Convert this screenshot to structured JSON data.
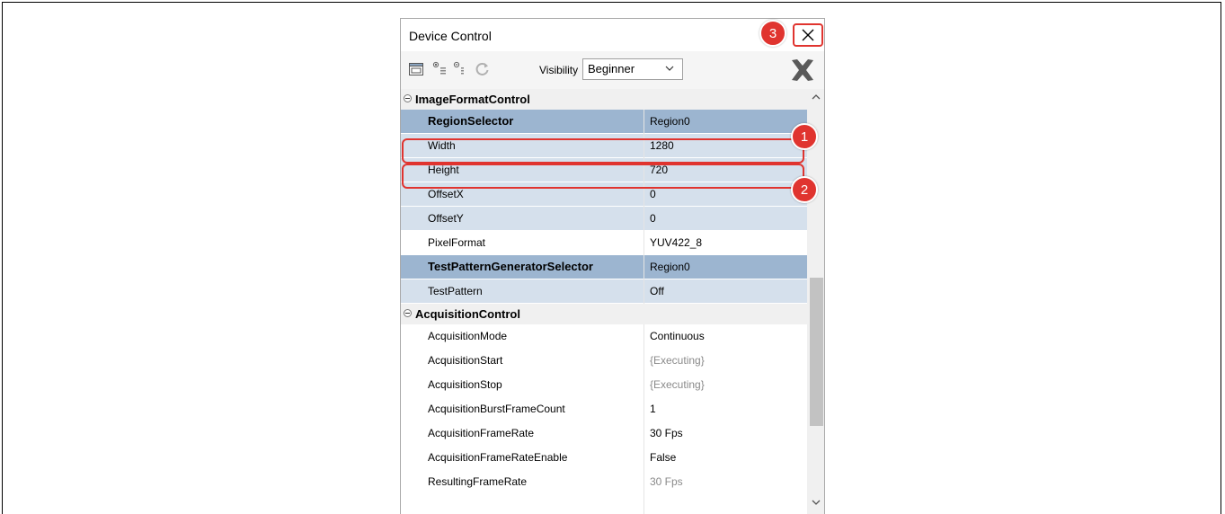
{
  "window": {
    "title": "Device Control"
  },
  "toolbar": {
    "visibility_label": "Visibility",
    "visibility_value": "Beginner",
    "icons": [
      "properties-icon",
      "expand-all-icon",
      "collapse-all-icon",
      "refresh-icon",
      "delete-icon"
    ]
  },
  "categories": [
    {
      "label": "ImageFormatControl",
      "rows": [
        {
          "name": "RegionSelector",
          "value": "Region0",
          "style": "sel"
        },
        {
          "name": "Width",
          "value": "1280",
          "style": "edit"
        },
        {
          "name": "Height",
          "value": "720",
          "style": "edit"
        },
        {
          "name": "OffsetX",
          "value": "0",
          "style": "edit"
        },
        {
          "name": "OffsetY",
          "value": "0",
          "style": "edit"
        },
        {
          "name": "PixelFormat",
          "value": "YUV422_8",
          "style": "white"
        },
        {
          "name": "TestPatternGeneratorSelector",
          "value": "Region0",
          "style": "sel"
        },
        {
          "name": "TestPattern",
          "value": "Off",
          "style": "edit"
        }
      ]
    },
    {
      "label": "AcquisitionControl",
      "rows": [
        {
          "name": "AcquisitionMode",
          "value": "Continuous",
          "style": "white"
        },
        {
          "name": "AcquisitionStart",
          "value": "{Executing}",
          "style": "white",
          "muted": true
        },
        {
          "name": "AcquisitionStop",
          "value": "{Executing}",
          "style": "white",
          "muted": true
        },
        {
          "name": "AcquisitionBurstFrameCount",
          "value": "1",
          "style": "white"
        },
        {
          "name": "AcquisitionFrameRate",
          "value": "30 Fps",
          "style": "white"
        },
        {
          "name": "AcquisitionFrameRateEnable",
          "value": "False",
          "style": "white"
        },
        {
          "name": "ResultingFrameRate",
          "value": "30 Fps",
          "style": "white",
          "muted": true
        }
      ]
    }
  ],
  "annotations": [
    "1",
    "2",
    "3"
  ],
  "colors": {
    "highlight": "#e0342f",
    "selected_row": "#9cb5d0",
    "editable_row": "#d5e0ec"
  }
}
